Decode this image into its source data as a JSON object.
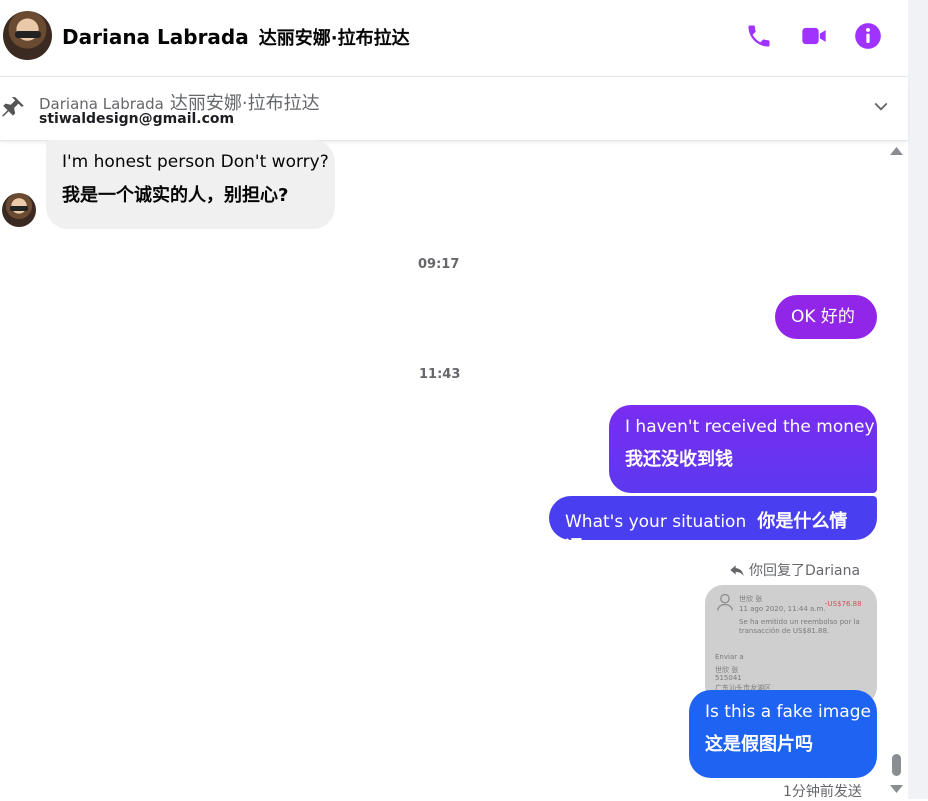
{
  "header": {
    "name": "Dariana Labrada",
    "name_cn": "达丽安娜·拉布拉达",
    "icons": [
      "phone-icon",
      "video-icon",
      "info-icon"
    ],
    "accent": "#a033ff"
  },
  "pinned": {
    "name": "Dariana Labrada",
    "name_cn": "达丽安娜·拉布拉达",
    "email": "stiwaldesign@gmail.com"
  },
  "messages": {
    "m1": {
      "en": "I'm honest person Don't worry?",
      "cn": "我是一个诚实的人，别担心?"
    },
    "time1": "09:17",
    "m2": {
      "text": "OK  好的"
    },
    "time2": "11:43",
    "m3": {
      "en": "I haven't received the money",
      "cn": "我还没收到钱"
    },
    "m4": {
      "en": "What's your situation",
      "cn": "你是什么情况"
    },
    "reply_label": "你回复了Dariana",
    "image": {
      "name": "世欣 张",
      "date": "11 ago 2020, 11:44 a.m.",
      "amount": "-US$76.88",
      "line1": "Se ha emitido un reembolso por la",
      "line2": "transacción de US$81.88.",
      "send_to": "Enviar a",
      "name2": "世欣 张",
      "zip": "515041",
      "region": "广东汕头市龙湖区"
    },
    "m5": {
      "en": "Is this a fake image",
      "cn": "这是假图片吗"
    },
    "sent_status": "1分钟前发送"
  },
  "colors": {
    "ok_bubble": "#9126e8",
    "m3_gradient": [
      "#7a2cf0",
      "#5a3cf0"
    ],
    "m4_bubble": "#4a3ff0",
    "m5_bubble": "#1f63f2"
  }
}
